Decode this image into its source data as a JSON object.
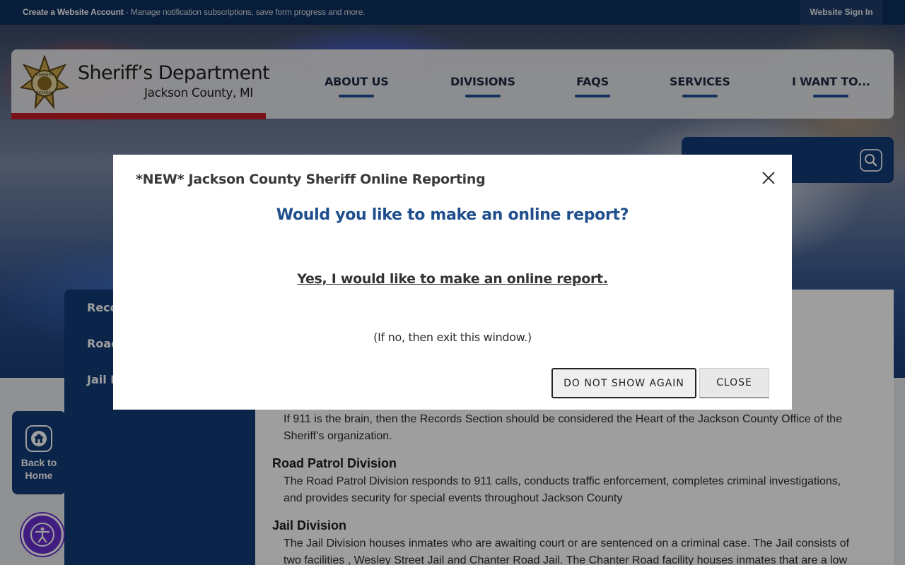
{
  "topbar": {
    "account_label": "Create a Website Account",
    "account_desc": " - Manage notification subscriptions, save form progress and more.",
    "signin_label": "Website Sign In"
  },
  "header": {
    "dept_name": "Sheriff’s Department",
    "dept_sub": "Jackson County, MI",
    "badge_text_top": "SHERIFF",
    "badge_text_bottom": "MICHIGAN",
    "nav": [
      "ABOUT US",
      "DIVISIONS",
      "FAQS",
      "SERVICES",
      "I WANT TO..."
    ]
  },
  "sidebar": {
    "items": [
      "Reco",
      "Road",
      "Jail D"
    ]
  },
  "back_home": {
    "line1": "Back to",
    "line2": "Home"
  },
  "content": {
    "records_text_1": "If 911 is the brain, then the Records Section should be considered the Heart of the Jackson County Office of the",
    "records_text_2": "Sheriff’s organization.",
    "road_heading": "Road Patrol Division",
    "road_text_1": "The Road Patrol Division responds to 911 calls, conducts traffic enforcement, completes criminal investigations,",
    "road_text_2": "and provides security for special events throughout Jackson County",
    "jail_heading": "Jail Division",
    "jail_text_1": "The Jail Division houses inmates who are awaiting court or are sentenced on a criminal case. The Jail consists of",
    "jail_text_2": "two facilities , Wesley Street Jail and Chanter Road Jail. The Chanter Road facility houses inmates that are a low"
  },
  "modal": {
    "title": "*NEW* Jackson County Sheriff Online Reporting",
    "question": "Would you like to make an online report?",
    "link": "Yes, I would like to make an online report.",
    "note": "(If no, then exit this window.)",
    "do_not_show_label": "DO NOT SHOW AGAIN",
    "close_label": "CLOSE"
  },
  "colors": {
    "navy": "#0e2f5e",
    "sidebar_blue": "#123b78",
    "accent_red": "#c51c24",
    "question_blue": "#1f4e8c",
    "a11y_purple": "#6b2fd0"
  },
  "icons": [
    "sheriff-badge-icon",
    "search-icon",
    "home-icon",
    "accessibility-icon",
    "close-icon"
  ]
}
